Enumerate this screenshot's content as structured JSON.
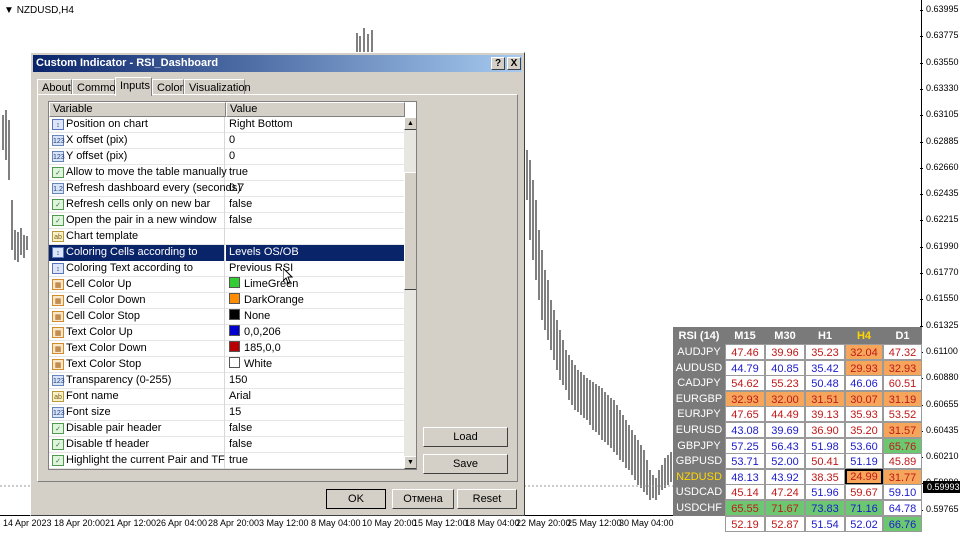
{
  "chart": {
    "symbol_label": "NZDUSD,H4",
    "price_ticks": [
      "0.63995",
      "0.63775",
      "0.63550",
      "0.63330",
      "0.63105",
      "0.62885",
      "0.62660",
      "0.62435",
      "0.62215",
      "0.61990",
      "0.61770",
      "0.61550",
      "0.61325",
      "0.61100",
      "0.60880",
      "0.60655",
      "0.60435",
      "0.60210",
      "0.59990",
      "0.59765"
    ],
    "current_price": "0.59993",
    "time_ticks": [
      "14 Apr 2023",
      "18 Apr 20:00",
      "21 Apr 12:00",
      "26 Apr 04:00",
      "28 Apr 20:00",
      "3 May 12:00",
      "8 May 04:00",
      "10 May 20:00",
      "15 May 12:00",
      "18 May 04:00",
      "22 May 20:00",
      "25 May 12:00",
      "30 May 04:00"
    ]
  },
  "dialog": {
    "title": "Custom Indicator - RSI_Dashboard",
    "help_label": "?",
    "close_label": "X",
    "tabs": [
      "About",
      "Common",
      "Inputs",
      "Colors",
      "Visualization"
    ],
    "active_tab": "Inputs",
    "columns": {
      "variable": "Variable",
      "value": "Value"
    },
    "params": [
      {
        "name": "Position on chart",
        "value": "Right Bottom",
        "type": "enum",
        "icon": "enum-icon"
      },
      {
        "name": "X offset (pix)",
        "value": "0",
        "type": "int",
        "icon": "number-icon"
      },
      {
        "name": "Y offset (pix)",
        "value": "0",
        "type": "int",
        "icon": "number-icon"
      },
      {
        "name": "Allow to move the table manually",
        "value": "true",
        "type": "bool",
        "icon": "bool-icon"
      },
      {
        "name": "Refresh dashboard every (seconds)",
        "value": "0.7",
        "type": "double",
        "icon": "number-icon"
      },
      {
        "name": "Refresh cells only on new bar",
        "value": "false",
        "type": "bool",
        "icon": "bool-icon"
      },
      {
        "name": "Open the pair in a new window",
        "value": "false",
        "type": "bool",
        "icon": "bool-icon"
      },
      {
        "name": "Chart template",
        "value": "",
        "type": "str",
        "icon": "string-icon"
      },
      {
        "name": "Coloring Cells according to",
        "value": "Levels OS/OB",
        "type": "enum",
        "icon": "enum-icon",
        "selected": true
      },
      {
        "name": "Coloring Text according to",
        "value": "Previous RSI",
        "type": "enum",
        "icon": "enum-icon"
      },
      {
        "name": "Cell Color Up",
        "value": "LimeGreen",
        "type": "color",
        "icon": "color-icon",
        "swatch": "#32cd32"
      },
      {
        "name": "Cell Color Down",
        "value": "DarkOrange",
        "type": "color",
        "icon": "color-icon",
        "swatch": "#ff8c00"
      },
      {
        "name": "Cell Color Stop",
        "value": "None",
        "type": "color",
        "icon": "color-icon",
        "swatch": "#000000"
      },
      {
        "name": "Text Color Up",
        "value": "0,0,206",
        "type": "color",
        "icon": "color-icon",
        "swatch": "#0000ce"
      },
      {
        "name": "Text Color Down",
        "value": "185,0,0",
        "type": "color",
        "icon": "color-icon",
        "swatch": "#b90000"
      },
      {
        "name": "Text Color Stop",
        "value": "White",
        "type": "color",
        "icon": "color-icon",
        "swatch": "#ffffff"
      },
      {
        "name": "Transparency (0-255)",
        "value": "150",
        "type": "int",
        "icon": "number-icon"
      },
      {
        "name": "Font name",
        "value": "Arial",
        "type": "str",
        "icon": "string-icon"
      },
      {
        "name": "Font size",
        "value": "15",
        "type": "int",
        "icon": "number-icon"
      },
      {
        "name": "Disable pair header",
        "value": "false",
        "type": "bool",
        "icon": "bool-icon"
      },
      {
        "name": "Disable tf header",
        "value": "false",
        "type": "bool",
        "icon": "bool-icon"
      },
      {
        "name": "Highlight the current Pair and TF",
        "value": "true",
        "type": "bool",
        "icon": "bool-icon"
      }
    ],
    "load_label": "Load",
    "save_label": "Save",
    "ok_label": "OK",
    "cancel_label": "Отмена",
    "reset_label": "Reset"
  },
  "rsi": {
    "title": "RSI (14)",
    "timeframes": [
      "M15",
      "M30",
      "H1",
      "H4",
      "D1"
    ],
    "highlight_tf": "H4",
    "highlight_pair": "NZDUSD",
    "colors": {
      "header_bg": "#7a7a7a",
      "highlight_text": "#ffd700",
      "green": "#6cc870",
      "orange": "#f5a65b",
      "up_text": "#1a1acb",
      "down_text": "#c01818"
    },
    "rows": [
      {
        "pair": "AUDJPY",
        "cells": [
          {
            "v": "47.46",
            "t": "down"
          },
          {
            "v": "39.96",
            "t": "down"
          },
          {
            "v": "35.23",
            "t": "down"
          },
          {
            "v": "32.04",
            "t": "down",
            "c": "orange"
          },
          {
            "v": "47.32",
            "t": "down"
          }
        ]
      },
      {
        "pair": "AUDUSD",
        "cells": [
          {
            "v": "44.79",
            "t": "up"
          },
          {
            "v": "40.85",
            "t": "up"
          },
          {
            "v": "35.42",
            "t": "up"
          },
          {
            "v": "29.93",
            "t": "down",
            "c": "orange"
          },
          {
            "v": "32.93",
            "t": "down",
            "c": "orange"
          }
        ]
      },
      {
        "pair": "CADJPY",
        "cells": [
          {
            "v": "54.62",
            "t": "down"
          },
          {
            "v": "55.23",
            "t": "down"
          },
          {
            "v": "50.48",
            "t": "up"
          },
          {
            "v": "46.06",
            "t": "up"
          },
          {
            "v": "60.51",
            "t": "down"
          }
        ]
      },
      {
        "pair": "EURGBP",
        "cells": [
          {
            "v": "32.93",
            "t": "down",
            "c": "orange"
          },
          {
            "v": "32.00",
            "t": "down",
            "c": "orange"
          },
          {
            "v": "31.51",
            "t": "down",
            "c": "orange"
          },
          {
            "v": "30.07",
            "t": "down",
            "c": "orange"
          },
          {
            "v": "31.19",
            "t": "down",
            "c": "orange"
          }
        ]
      },
      {
        "pair": "EURJPY",
        "cells": [
          {
            "v": "47.65",
            "t": "down"
          },
          {
            "v": "44.49",
            "t": "down"
          },
          {
            "v": "39.13",
            "t": "down"
          },
          {
            "v": "35.93",
            "t": "down"
          },
          {
            "v": "53.52",
            "t": "down"
          }
        ]
      },
      {
        "pair": "EURUSD",
        "cells": [
          {
            "v": "43.08",
            "t": "up"
          },
          {
            "v": "39.69",
            "t": "up"
          },
          {
            "v": "36.90",
            "t": "down"
          },
          {
            "v": "35.20",
            "t": "down"
          },
          {
            "v": "31.57",
            "t": "down",
            "c": "orange"
          }
        ]
      },
      {
        "pair": "GBPJPY",
        "cells": [
          {
            "v": "57.25",
            "t": "up"
          },
          {
            "v": "56.43",
            "t": "up"
          },
          {
            "v": "51.98",
            "t": "up"
          },
          {
            "v": "53.60",
            "t": "up"
          },
          {
            "v": "65.76",
            "t": "down",
            "c": "green"
          }
        ]
      },
      {
        "pair": "GBPUSD",
        "cells": [
          {
            "v": "53.71",
            "t": "up"
          },
          {
            "v": "52.00",
            "t": "up"
          },
          {
            "v": "50.41",
            "t": "down"
          },
          {
            "v": "51.19",
            "t": "up"
          },
          {
            "v": "45.89",
            "t": "down"
          }
        ]
      },
      {
        "pair": "NZDUSD",
        "cells": [
          {
            "v": "48.13",
            "t": "up"
          },
          {
            "v": "43.92",
            "t": "up"
          },
          {
            "v": "38.35",
            "t": "down"
          },
          {
            "v": "24.99",
            "t": "down",
            "c": "orange"
          },
          {
            "v": "31.77",
            "t": "down",
            "c": "orange"
          }
        ]
      },
      {
        "pair": "USDCAD",
        "cells": [
          {
            "v": "45.14",
            "t": "down"
          },
          {
            "v": "47.24",
            "t": "down"
          },
          {
            "v": "51.96",
            "t": "up"
          },
          {
            "v": "59.67",
            "t": "down"
          },
          {
            "v": "59.10",
            "t": "up"
          }
        ]
      },
      {
        "pair": "USDCHF",
        "cells": [
          {
            "v": "65.55",
            "t": "down",
            "c": "green"
          },
          {
            "v": "71.67",
            "t": "down",
            "c": "green"
          },
          {
            "v": "73.83",
            "t": "up",
            "c": "green"
          },
          {
            "v": "71.16",
            "t": "up",
            "c": "green"
          },
          {
            "v": "64.78",
            "t": "up"
          }
        ]
      },
      {
        "pair": "USDJPY",
        "cells": [
          {
            "v": "52.19",
            "t": "down"
          },
          {
            "v": "52.87",
            "t": "down"
          },
          {
            "v": "51.54",
            "t": "up"
          },
          {
            "v": "52.02",
            "t": "up"
          },
          {
            "v": "66.76",
            "t": "up",
            "c": "green"
          }
        ]
      }
    ]
  }
}
